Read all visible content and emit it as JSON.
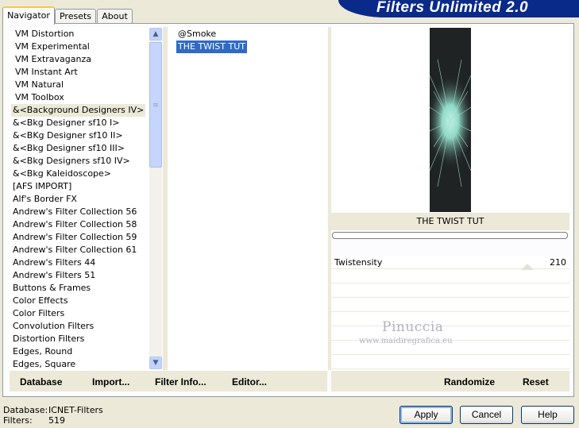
{
  "header": {
    "title": "Filters Unlimited 2.0"
  },
  "tabs": [
    {
      "label": "Navigator",
      "active": true
    },
    {
      "label": "Presets",
      "active": false
    },
    {
      "label": "About",
      "active": false
    }
  ],
  "filter_list": {
    "items": [
      "VM Distortion",
      "VM Experimental",
      "VM Extravaganza",
      "VM Instant Art",
      "VM Natural",
      "VM Toolbox",
      "&<Background Designers IV>",
      "&<Bkg Designer sf10 I>",
      "&<BKg Designer sf10 II>",
      "&<Bkg Designer sf10 III>",
      "&<Bkg Designers sf10 IV>",
      "&<Bkg Kaleidoscope>",
      "[AFS IMPORT]",
      "Alf's Border FX",
      "Andrew's Filter Collection 56",
      "Andrew's Filter Collection 58",
      "Andrew's Filter Collection 59",
      "Andrew's Filter Collection 61",
      "Andrew's Filters 44",
      "Andrew's Filters 51",
      "Buttons & Frames",
      "Color Effects",
      "Color Filters",
      "Convolution Filters",
      "Distortion Filters",
      "Edges, Round",
      "Edges, Square"
    ],
    "selected_index": 6
  },
  "effect_list": {
    "items": [
      "@Smoke",
      "THE TWIST TUT"
    ],
    "selected_index": 1
  },
  "preview": {
    "name": "THE TWIST TUT"
  },
  "params": [
    {
      "label": "Twistensity",
      "value": "210"
    }
  ],
  "watermark": {
    "main": "Pinuccia",
    "sub": "www.maidiregrafica.eu"
  },
  "actions": {
    "database": "Database",
    "import": "Import...",
    "filter_info": "Filter Info...",
    "editor": "Editor...",
    "randomize": "Randomize",
    "reset": "Reset"
  },
  "status": {
    "database_label": "Database:",
    "database_value": "ICNET-Filters",
    "filters_label": "Filters:",
    "filters_value": "519"
  },
  "buttons": {
    "apply": "Apply",
    "cancel": "Cancel",
    "help": "Help"
  },
  "colors": {
    "banner": "#0a2a8a",
    "selection": "#316ac5",
    "tab_highlight": "#ffc83c"
  }
}
